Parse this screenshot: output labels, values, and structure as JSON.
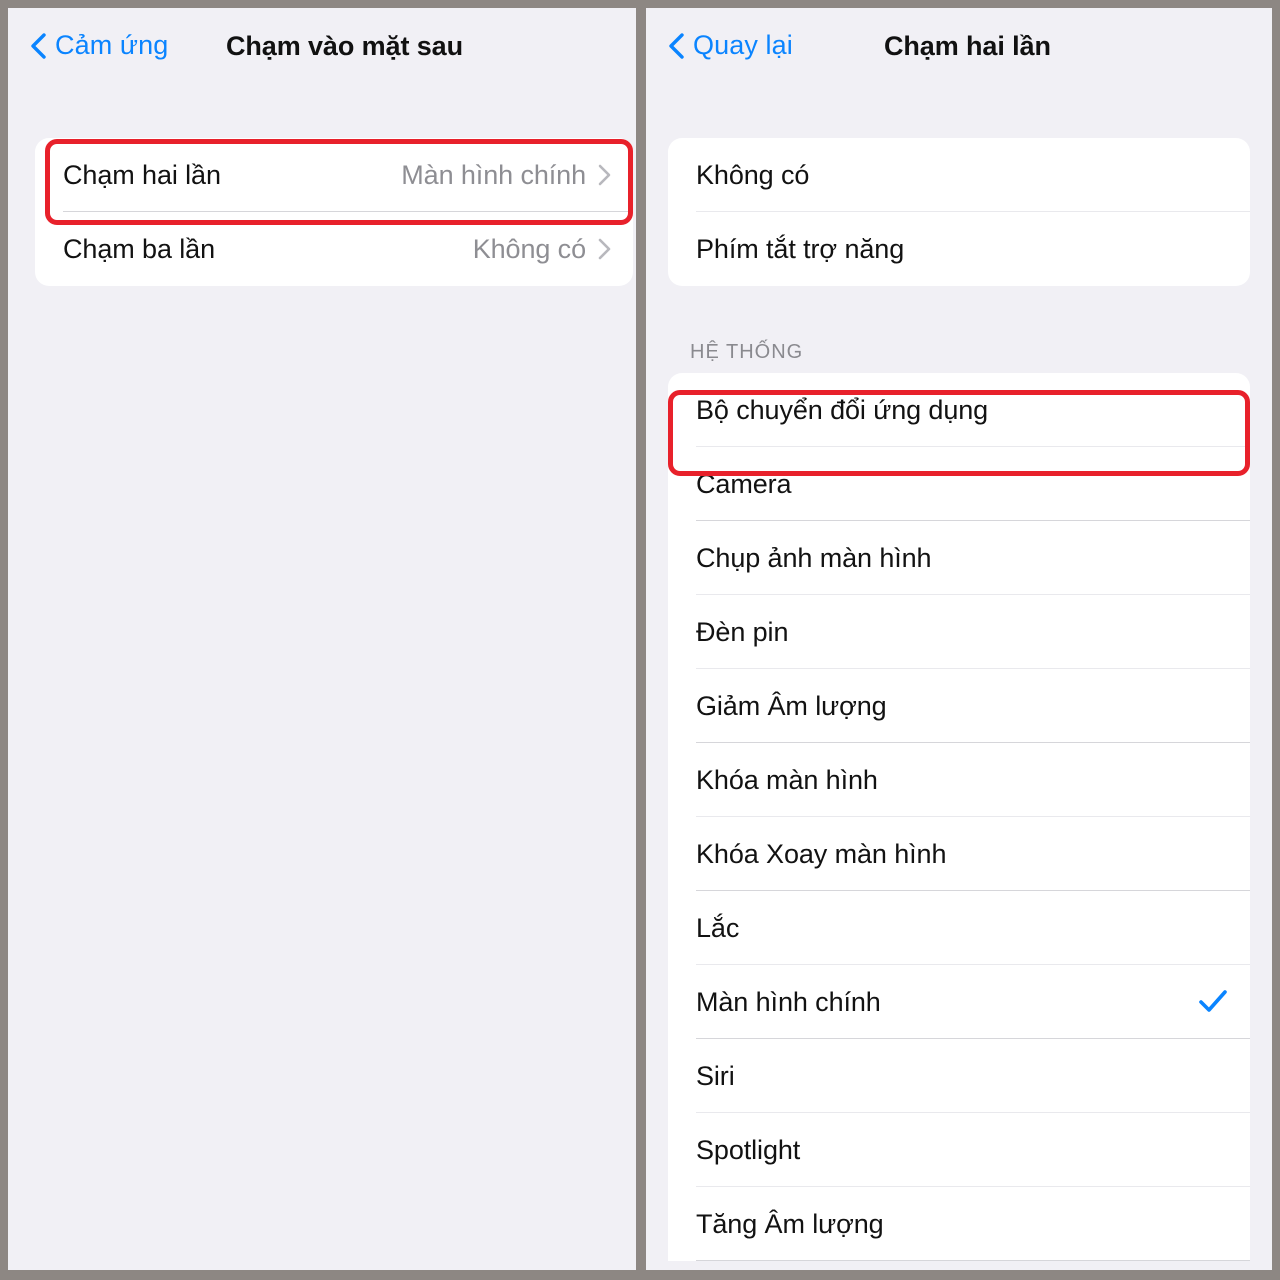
{
  "colors": {
    "accent_blue": "#0a84ff",
    "highlight_red": "#e8212b",
    "value_gray": "#8e8e93",
    "background": "#f1f0f5",
    "card": "#ffffff",
    "frame_gray": "#8d8783"
  },
  "left_panel": {
    "nav": {
      "back_label": "Cảm ứng",
      "title": "Chạm vào mặt sau"
    },
    "rows": [
      {
        "label": "Chạm hai lần",
        "value": "Màn hình chính",
        "highlighted": true
      },
      {
        "label": "Chạm ba lần",
        "value": "Không có",
        "highlighted": false
      }
    ]
  },
  "right_panel": {
    "nav": {
      "back_label": "Quay lại",
      "title": "Chạm hai lần"
    },
    "top_group": {
      "rows": [
        {
          "label": "Không có",
          "checked": false
        },
        {
          "label": "Phím tắt trợ năng",
          "checked": false
        }
      ]
    },
    "system_section": {
      "header": "HỆ THỐNG",
      "rows": [
        {
          "label": "Bộ chuyển đổi ứng dụng",
          "checked": false,
          "highlighted": false
        },
        {
          "label": "Camera",
          "checked": false,
          "highlighted": false
        },
        {
          "label": "Chụp ảnh màn hình",
          "checked": false,
          "highlighted": true
        },
        {
          "label": "Đèn pin",
          "checked": false,
          "highlighted": false
        },
        {
          "label": "Giảm Âm lượng",
          "checked": false,
          "highlighted": false
        },
        {
          "label": "Khóa màn hình",
          "checked": false,
          "highlighted": false
        },
        {
          "label": "Khóa Xoay màn hình",
          "checked": false,
          "highlighted": false
        },
        {
          "label": "Lắc",
          "checked": false,
          "highlighted": false
        },
        {
          "label": "Màn hình chính",
          "checked": true,
          "highlighted": false
        },
        {
          "label": "Siri",
          "checked": false,
          "highlighted": false
        },
        {
          "label": "Spotlight",
          "checked": false,
          "highlighted": false
        },
        {
          "label": "Tăng Âm lượng",
          "checked": false,
          "highlighted": false
        }
      ]
    }
  }
}
